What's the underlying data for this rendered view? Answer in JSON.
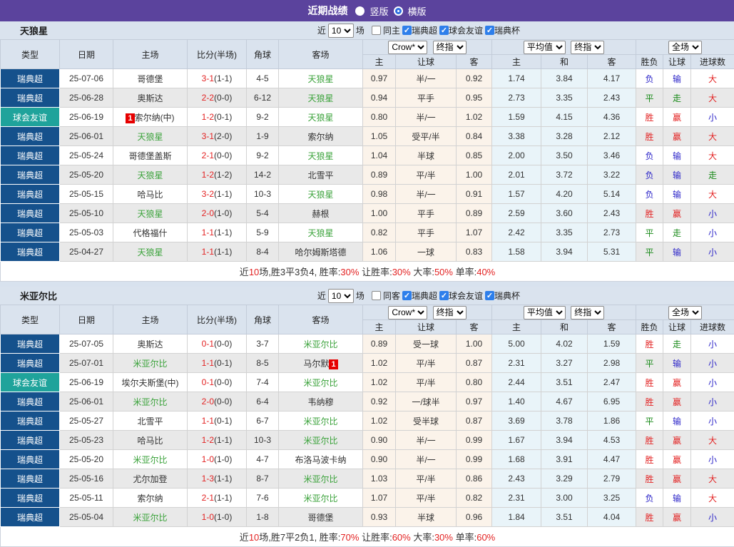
{
  "topbar": {
    "title": "近期战绩",
    "radio_vertical": "竖版",
    "radio_horizontal": "横版",
    "selected": "横版"
  },
  "controls": {
    "near_label": "近",
    "matches_select": "10",
    "matches_label": "场",
    "league_filters": [
      "瑞典超",
      "球会友谊",
      "瑞典杯"
    ]
  },
  "header": {
    "left_cols": [
      "类型",
      "日期",
      "主场",
      "比分(半场)",
      "角球",
      "客场"
    ],
    "crow_select": "Crow*",
    "final_select": "终指",
    "avg_select": "平均值",
    "full_select": "全场",
    "sub_cols": [
      "主",
      "让球",
      "客",
      "主",
      "和",
      "客",
      "胜负",
      "让球",
      "进球数"
    ]
  },
  "colors": {
    "accent_purple": "#5B439D",
    "type_super": "#15518C",
    "type_friendly": "#1FA39B",
    "team_green": "#3AA23A",
    "score_red": "#E32222",
    "red": "#E32222",
    "blue": "#2B24C8",
    "green": "#178917",
    "badge_red": "#E60000",
    "check_blue": "#2E7FEB"
  },
  "sections": [
    {
      "team": "天狼星",
      "same_side_label": "同主",
      "rows": [
        {
          "type": "瑞典超",
          "type_key": "super",
          "date": "25-07-06",
          "home": "哥德堡",
          "home_team": false,
          "score": "3-1",
          "half": "(1-1)",
          "corner": "4-5",
          "away": "天狼星",
          "away_team": true,
          "crow": [
            "0.97",
            "半/一",
            "0.92"
          ],
          "avg": [
            "1.74",
            "3.84",
            "4.17"
          ],
          "outcome": [
            {
              "t": "负",
              "c": "blue"
            },
            {
              "t": "输",
              "c": "blue"
            },
            {
              "t": "大",
              "c": "red"
            }
          ]
        },
        {
          "type": "瑞典超",
          "type_key": "super",
          "date": "25-06-28",
          "home": "奥斯达",
          "home_team": false,
          "score": "2-2",
          "half": "(0-0)",
          "corner": "6-12",
          "away": "天狼星",
          "away_team": true,
          "crow": [
            "0.94",
            "平手",
            "0.95"
          ],
          "avg": [
            "2.73",
            "3.35",
            "2.43"
          ],
          "outcome": [
            {
              "t": "平",
              "c": "green"
            },
            {
              "t": "走",
              "c": "green"
            },
            {
              "t": "大",
              "c": "red"
            }
          ]
        },
        {
          "type": "球会友谊",
          "type_key": "friendly",
          "date": "25-06-19",
          "home": "索尔纳(中)",
          "home_badge_pre": "1",
          "home_team": false,
          "score": "1-2",
          "half": "(0-1)",
          "corner": "9-2",
          "away": "天狼星",
          "away_team": true,
          "crow": [
            "0.80",
            "半/一",
            "1.02"
          ],
          "avg": [
            "1.59",
            "4.15",
            "4.36"
          ],
          "outcome": [
            {
              "t": "胜",
              "c": "red"
            },
            {
              "t": "赢",
              "c": "red"
            },
            {
              "t": "小",
              "c": "blue"
            }
          ]
        },
        {
          "type": "瑞典超",
          "type_key": "super",
          "date": "25-06-01",
          "home": "天狼星",
          "home_team": true,
          "score": "3-1",
          "half": "(2-0)",
          "corner": "1-9",
          "away": "索尔纳",
          "away_team": false,
          "crow": [
            "1.05",
            "受平/半",
            "0.84"
          ],
          "avg": [
            "3.38",
            "3.28",
            "2.12"
          ],
          "outcome": [
            {
              "t": "胜",
              "c": "red"
            },
            {
              "t": "赢",
              "c": "red"
            },
            {
              "t": "大",
              "c": "red"
            }
          ]
        },
        {
          "type": "瑞典超",
          "type_key": "super",
          "date": "25-05-24",
          "home": "哥德堡盖斯",
          "home_team": false,
          "score": "2-1",
          "half": "(0-0)",
          "corner": "9-2",
          "away": "天狼星",
          "away_team": true,
          "crow": [
            "1.04",
            "半球",
            "0.85"
          ],
          "avg": [
            "2.00",
            "3.50",
            "3.46"
          ],
          "outcome": [
            {
              "t": "负",
              "c": "blue"
            },
            {
              "t": "输",
              "c": "blue"
            },
            {
              "t": "大",
              "c": "red"
            }
          ]
        },
        {
          "type": "瑞典超",
          "type_key": "super",
          "date": "25-05-20",
          "home": "天狼星",
          "home_team": true,
          "score": "1-2",
          "half": "(1-2)",
          "corner": "14-2",
          "away": "北雪平",
          "away_team": false,
          "crow": [
            "0.89",
            "平/半",
            "1.00"
          ],
          "avg": [
            "2.01",
            "3.72",
            "3.22"
          ],
          "outcome": [
            {
              "t": "负",
              "c": "blue"
            },
            {
              "t": "输",
              "c": "blue"
            },
            {
              "t": "走",
              "c": "green"
            }
          ]
        },
        {
          "type": "瑞典超",
          "type_key": "super",
          "date": "25-05-15",
          "home": "哈马比",
          "home_team": false,
          "score": "3-2",
          "half": "(1-1)",
          "corner": "10-3",
          "away": "天狼星",
          "away_team": true,
          "crow": [
            "0.98",
            "半/一",
            "0.91"
          ],
          "avg": [
            "1.57",
            "4.20",
            "5.14"
          ],
          "outcome": [
            {
              "t": "负",
              "c": "blue"
            },
            {
              "t": "输",
              "c": "blue"
            },
            {
              "t": "大",
              "c": "red"
            }
          ]
        },
        {
          "type": "瑞典超",
          "type_key": "super",
          "date": "25-05-10",
          "home": "天狼星",
          "home_team": true,
          "score": "2-0",
          "half": "(1-0)",
          "corner": "5-4",
          "away": "赫根",
          "away_team": false,
          "crow": [
            "1.00",
            "平手",
            "0.89"
          ],
          "avg": [
            "2.59",
            "3.60",
            "2.43"
          ],
          "outcome": [
            {
              "t": "胜",
              "c": "red"
            },
            {
              "t": "赢",
              "c": "red"
            },
            {
              "t": "小",
              "c": "blue"
            }
          ]
        },
        {
          "type": "瑞典超",
          "type_key": "super",
          "date": "25-05-03",
          "home": "代格福什",
          "home_team": false,
          "score": "1-1",
          "half": "(1-1)",
          "corner": "5-9",
          "away": "天狼星",
          "away_team": true,
          "crow": [
            "0.82",
            "平手",
            "1.07"
          ],
          "avg": [
            "2.42",
            "3.35",
            "2.73"
          ],
          "outcome": [
            {
              "t": "平",
              "c": "green"
            },
            {
              "t": "走",
              "c": "green"
            },
            {
              "t": "小",
              "c": "blue"
            }
          ]
        },
        {
          "type": "瑞典超",
          "type_key": "super",
          "date": "25-04-27",
          "home": "天狼星",
          "home_team": true,
          "score": "1-1",
          "half": "(1-1)",
          "corner": "8-4",
          "away": "哈尔姆斯塔德",
          "away_team": false,
          "crow": [
            "1.06",
            "一球",
            "0.83"
          ],
          "avg": [
            "1.58",
            "3.94",
            "5.31"
          ],
          "outcome": [
            {
              "t": "平",
              "c": "green"
            },
            {
              "t": "输",
              "c": "blue"
            },
            {
              "t": "小",
              "c": "blue"
            }
          ]
        }
      ],
      "summary": [
        {
          "t": "近",
          "red": false
        },
        {
          "t": "10",
          "red": true
        },
        {
          "t": "场,胜3平3负4, 胜率:",
          "red": false
        },
        {
          "t": "30%",
          "red": true
        },
        {
          "t": " 让胜率:",
          "red": false
        },
        {
          "t": "30%",
          "red": true
        },
        {
          "t": " 大率:",
          "red": false
        },
        {
          "t": "50%",
          "red": true
        },
        {
          "t": " 单率:",
          "red": false
        },
        {
          "t": "40%",
          "red": true
        }
      ]
    },
    {
      "team": "米亚尔比",
      "same_side_label": "同客",
      "rows": [
        {
          "type": "瑞典超",
          "type_key": "super",
          "date": "25-07-05",
          "home": "奥斯达",
          "home_team": false,
          "score": "0-1",
          "half": "(0-0)",
          "corner": "3-7",
          "away": "米亚尔比",
          "away_team": true,
          "crow": [
            "0.89",
            "受一球",
            "1.00"
          ],
          "avg": [
            "5.00",
            "4.02",
            "1.59"
          ],
          "outcome": [
            {
              "t": "胜",
              "c": "red"
            },
            {
              "t": "走",
              "c": "green"
            },
            {
              "t": "小",
              "c": "blue"
            }
          ]
        },
        {
          "type": "瑞典超",
          "type_key": "super",
          "date": "25-07-01",
          "home": "米亚尔比",
          "home_team": true,
          "score": "1-1",
          "half": "(0-1)",
          "corner": "8-5",
          "away": "马尔默",
          "away_badge_post": "1",
          "away_team": false,
          "crow": [
            "1.02",
            "平/半",
            "0.87"
          ],
          "avg": [
            "2.31",
            "3.27",
            "2.98"
          ],
          "outcome": [
            {
              "t": "平",
              "c": "green"
            },
            {
              "t": "输",
              "c": "blue"
            },
            {
              "t": "小",
              "c": "blue"
            }
          ]
        },
        {
          "type": "球会友谊",
          "type_key": "friendly",
          "date": "25-06-19",
          "home": "埃尔夫斯堡(中)",
          "home_team": false,
          "score": "0-1",
          "half": "(0-0)",
          "corner": "7-4",
          "away": "米亚尔比",
          "away_team": true,
          "crow": [
            "1.02",
            "平/半",
            "0.80"
          ],
          "avg": [
            "2.44",
            "3.51",
            "2.47"
          ],
          "outcome": [
            {
              "t": "胜",
              "c": "red"
            },
            {
              "t": "赢",
              "c": "red"
            },
            {
              "t": "小",
              "c": "blue"
            }
          ]
        },
        {
          "type": "瑞典超",
          "type_key": "super",
          "date": "25-06-01",
          "home": "米亚尔比",
          "home_team": true,
          "score": "2-0",
          "half": "(0-0)",
          "corner": "6-4",
          "away": "韦纳穆",
          "away_team": false,
          "crow": [
            "0.92",
            "一/球半",
            "0.97"
          ],
          "avg": [
            "1.40",
            "4.67",
            "6.95"
          ],
          "outcome": [
            {
              "t": "胜",
              "c": "red"
            },
            {
              "t": "赢",
              "c": "red"
            },
            {
              "t": "小",
              "c": "blue"
            }
          ]
        },
        {
          "type": "瑞典超",
          "type_key": "super",
          "date": "25-05-27",
          "home": "北雪平",
          "home_team": false,
          "score": "1-1",
          "half": "(0-1)",
          "corner": "6-7",
          "away": "米亚尔比",
          "away_team": true,
          "crow": [
            "1.02",
            "受半球",
            "0.87"
          ],
          "avg": [
            "3.69",
            "3.78",
            "1.86"
          ],
          "outcome": [
            {
              "t": "平",
              "c": "green"
            },
            {
              "t": "输",
              "c": "blue"
            },
            {
              "t": "小",
              "c": "blue"
            }
          ]
        },
        {
          "type": "瑞典超",
          "type_key": "super",
          "date": "25-05-23",
          "home": "哈马比",
          "home_team": false,
          "score": "1-2",
          "half": "(1-1)",
          "corner": "10-3",
          "away": "米亚尔比",
          "away_team": true,
          "crow": [
            "0.90",
            "半/一",
            "0.99"
          ],
          "avg": [
            "1.67",
            "3.94",
            "4.53"
          ],
          "outcome": [
            {
              "t": "胜",
              "c": "red"
            },
            {
              "t": "赢",
              "c": "red"
            },
            {
              "t": "大",
              "c": "red"
            }
          ]
        },
        {
          "type": "瑞典超",
          "type_key": "super",
          "date": "25-05-20",
          "home": "米亚尔比",
          "home_team": true,
          "score": "1-0",
          "half": "(1-0)",
          "corner": "4-7",
          "away": "布洛马波卡纳",
          "away_team": false,
          "crow": [
            "0.90",
            "半/一",
            "0.99"
          ],
          "avg": [
            "1.68",
            "3.91",
            "4.47"
          ],
          "outcome": [
            {
              "t": "胜",
              "c": "red"
            },
            {
              "t": "赢",
              "c": "red"
            },
            {
              "t": "小",
              "c": "blue"
            }
          ]
        },
        {
          "type": "瑞典超",
          "type_key": "super",
          "date": "25-05-16",
          "home": "尤尔加登",
          "home_team": false,
          "score": "1-3",
          "half": "(1-1)",
          "corner": "8-7",
          "away": "米亚尔比",
          "away_team": true,
          "crow": [
            "1.03",
            "平/半",
            "0.86"
          ],
          "avg": [
            "2.43",
            "3.29",
            "2.79"
          ],
          "outcome": [
            {
              "t": "胜",
              "c": "red"
            },
            {
              "t": "赢",
              "c": "red"
            },
            {
              "t": "大",
              "c": "red"
            }
          ]
        },
        {
          "type": "瑞典超",
          "type_key": "super",
          "date": "25-05-11",
          "home": "索尔纳",
          "home_team": false,
          "score": "2-1",
          "half": "(1-1)",
          "corner": "7-6",
          "away": "米亚尔比",
          "away_team": true,
          "crow": [
            "1.07",
            "平/半",
            "0.82"
          ],
          "avg": [
            "2.31",
            "3.00",
            "3.25"
          ],
          "outcome": [
            {
              "t": "负",
              "c": "blue"
            },
            {
              "t": "输",
              "c": "blue"
            },
            {
              "t": "大",
              "c": "red"
            }
          ]
        },
        {
          "type": "瑞典超",
          "type_key": "super",
          "date": "25-05-04",
          "home": "米亚尔比",
          "home_team": true,
          "score": "1-0",
          "half": "(1-0)",
          "corner": "1-8",
          "away": "哥德堡",
          "away_team": false,
          "crow": [
            "0.93",
            "半球",
            "0.96"
          ],
          "avg": [
            "1.84",
            "3.51",
            "4.04"
          ],
          "outcome": [
            {
              "t": "胜",
              "c": "red"
            },
            {
              "t": "赢",
              "c": "red"
            },
            {
              "t": "小",
              "c": "blue"
            }
          ]
        }
      ],
      "summary": [
        {
          "t": "近",
          "red": false
        },
        {
          "t": "10",
          "red": true
        },
        {
          "t": "场,胜7平2负1, 胜率:",
          "red": false
        },
        {
          "t": "70%",
          "red": true
        },
        {
          "t": " 让胜率:",
          "red": false
        },
        {
          "t": "60%",
          "red": true
        },
        {
          "t": " 大率:",
          "red": false
        },
        {
          "t": "30%",
          "red": true
        },
        {
          "t": " 单率:",
          "red": false
        },
        {
          "t": "60%",
          "red": true
        }
      ]
    }
  ]
}
